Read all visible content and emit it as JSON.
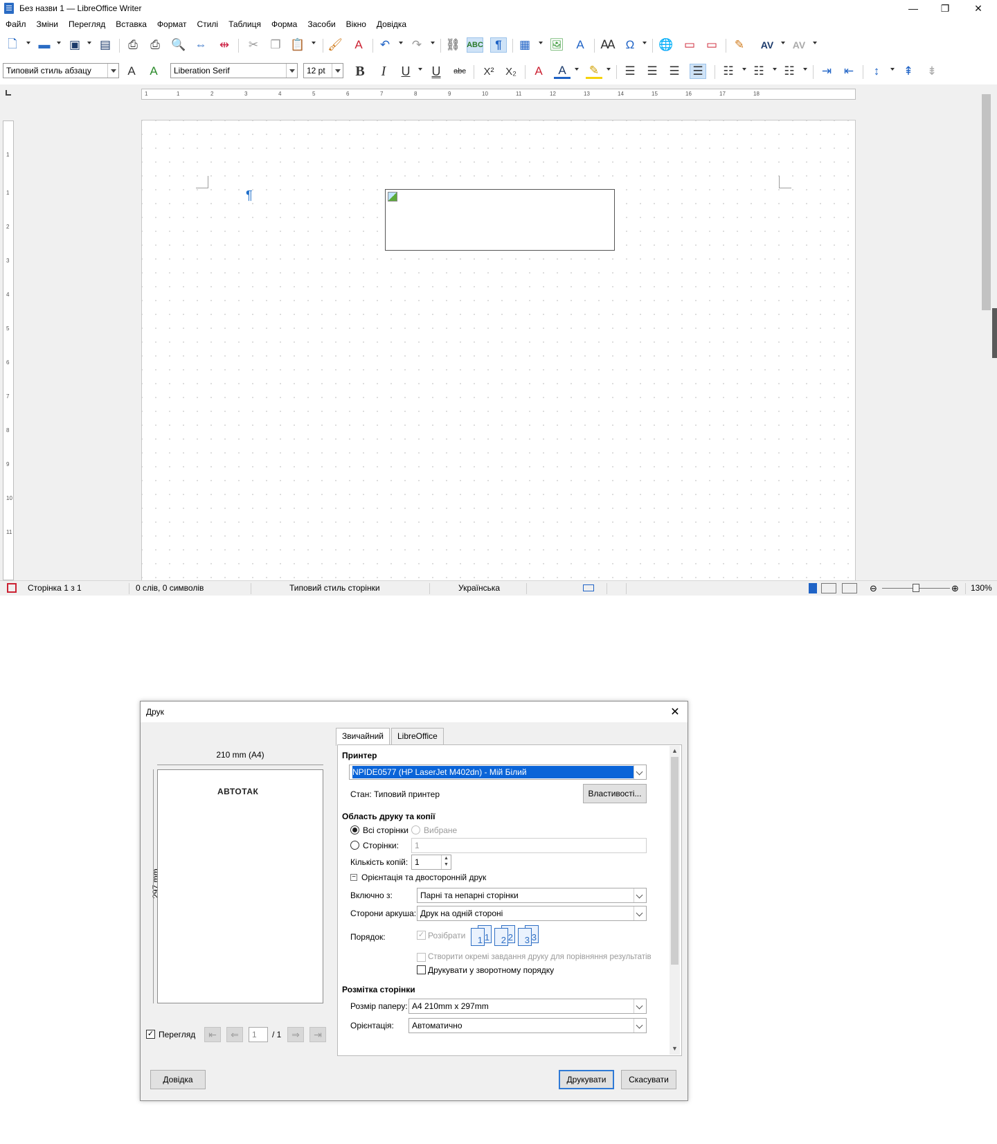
{
  "window": {
    "title": "Без назви 1 — LibreOffice Writer",
    "minimize": "—",
    "maximize": "❐",
    "close": "✕"
  },
  "menu": [
    "Файл",
    "Зміни",
    "Перегляд",
    "Вставка",
    "Формат",
    "Стилі",
    "Таблиця",
    "Форма",
    "Засоби",
    "Вікно",
    "Довідка"
  ],
  "formatting": {
    "paragraph_style": "Типовий стиль абзацу",
    "font_name": "Liberation Serif",
    "font_size": "12 pt",
    "bold": "B",
    "italic": "I",
    "underline": "U",
    "double_underline": "U",
    "strike": "abc",
    "superscript": "X²",
    "subscript": "X₂"
  },
  "ruler": {
    "horizontal": [
      "1",
      "1",
      "2",
      "3",
      "4",
      "5",
      "6",
      "7",
      "8",
      "9",
      "10",
      "11",
      "12",
      "13",
      "14",
      "15",
      "16",
      "17",
      "18"
    ],
    "vertical": [
      "1",
      "1",
      "2",
      "3",
      "4",
      "5",
      "6",
      "7",
      "8",
      "9",
      "10",
      "11"
    ]
  },
  "document": {
    "pilcrow": "¶"
  },
  "status": {
    "page": "Сторінка 1 з 1",
    "words": "0 слів, 0 символів",
    "page_style": "Типовий стиль сторінки",
    "language": "Українська",
    "zoom": "130%"
  },
  "print_dialog": {
    "title": "Друк",
    "close": "✕",
    "preview": {
      "width_label": "210 mm (A4)",
      "height_label": "297 mm",
      "logo": "АВТОТАК",
      "show_preview_label": "Перегляд",
      "show_preview_checked": true,
      "page_current": "1",
      "page_total": "/ 1"
    },
    "tabs": [
      "Звичайний",
      "LibreOffice Writer"
    ],
    "printer": {
      "header": "Принтер",
      "selected": "NPIDE0577 (HP LaserJet M402dn) - Мій Білий",
      "status_label": "Стан:",
      "status_value": "Типовий принтер",
      "properties_button": "Властивості..."
    },
    "range": {
      "header": "Область друку та копії",
      "all_pages": "Всі сторінки",
      "selection": "Вибране",
      "pages": "Сторінки:",
      "pages_value": "1",
      "copies_label": "Кількість копій:",
      "copies_value": "1",
      "orientation_duplex": "Орієнтація та двосторонній друк",
      "include_label": "Включно з:",
      "include_value": "Парні та непарні сторінки",
      "sides_label": "Сторони аркуша:",
      "sides_value": "Друк на одній стороні",
      "order_label": "Порядок:",
      "collate": "Розібрати",
      "separate_jobs": "Створити окремі завдання друку для порівняння результатів",
      "reverse_order": "Друкувати у зворотному порядку"
    },
    "layout": {
      "header": "Розмітка сторінки",
      "paper_size_label": "Розмір паперу:",
      "paper_size_value": "A4 210mm x 297mm",
      "orientation_label": "Орієнтація:",
      "orientation_value": "Автоматично"
    },
    "buttons": {
      "help": "Довідка",
      "print": "Друкувати",
      "cancel": "Скасувати"
    }
  }
}
